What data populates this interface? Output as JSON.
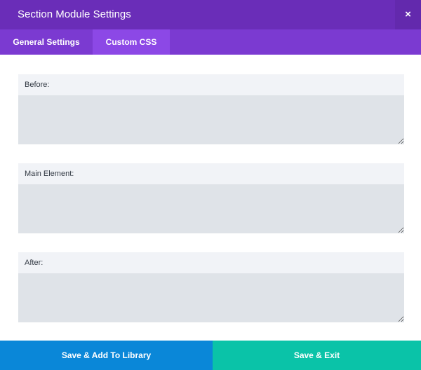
{
  "modal": {
    "title": "Section Module Settings",
    "close_icon": "×"
  },
  "tabs": [
    {
      "label": "General Settings",
      "active": false
    },
    {
      "label": "Custom CSS",
      "active": true
    }
  ],
  "fields": [
    {
      "label": "Before:",
      "value": ""
    },
    {
      "label": "Main Element:",
      "value": ""
    },
    {
      "label": "After:",
      "value": ""
    }
  ],
  "footer": {
    "library_label": "Save & Add To Library",
    "exit_label": "Save & Exit"
  },
  "colors": {
    "header": "#6a2db8",
    "tabs_bar": "#7b3ad1",
    "active_tab": "#8c48e6",
    "library_button": "#0a87d8",
    "exit_button": "#0ac3a8"
  }
}
